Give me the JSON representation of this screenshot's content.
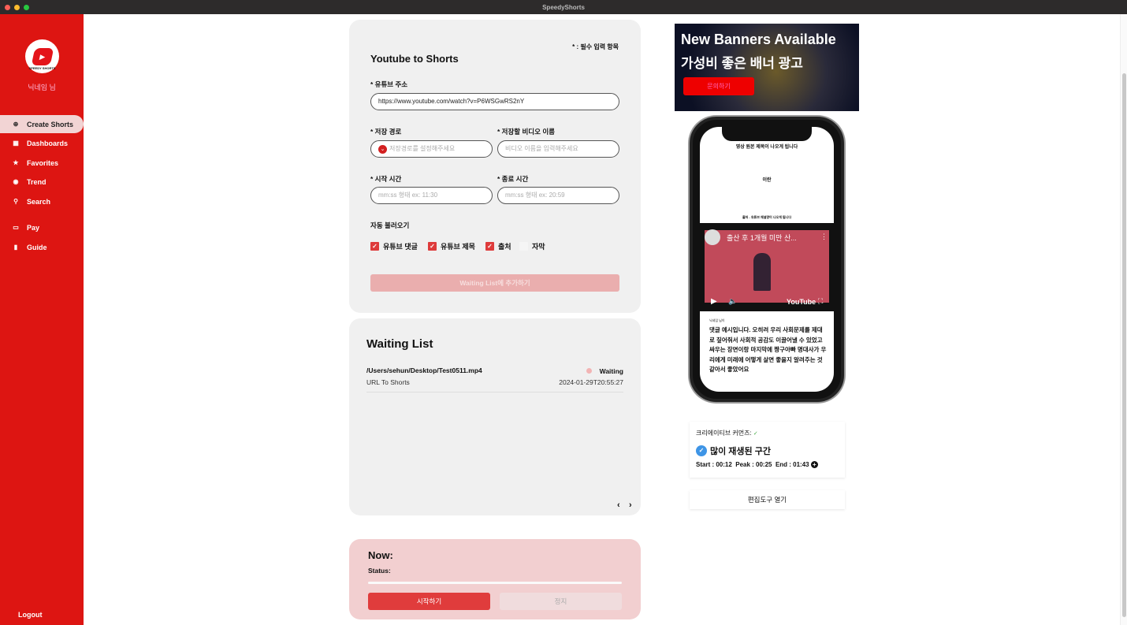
{
  "window": {
    "title": "SpeedyShorts"
  },
  "sidebar": {
    "logo_text": "SPEEDY SHORTS",
    "nickname": "닉네임 님",
    "items": [
      {
        "label": "Create Shorts",
        "icon": "plus-circle-icon"
      },
      {
        "label": "Dashboards",
        "icon": "dashboard-icon"
      },
      {
        "label": "Favorites",
        "icon": "star-icon"
      },
      {
        "label": "Trend",
        "icon": "compass-icon"
      },
      {
        "label": "Search",
        "icon": "search-icon"
      },
      {
        "label": "Pay",
        "icon": "card-icon"
      },
      {
        "label": "Guide",
        "icon": "book-icon"
      }
    ],
    "logout": "Logout",
    "color": "#dd1512"
  },
  "form": {
    "required_note": "* : 필수 입력 항목",
    "title": "Youtube to Shorts",
    "url_label": "* 유튜브 주소",
    "url_value": "https://www.youtube.com/watch?v=P6WSGwRS2nY",
    "path_label": "* 저장 경로",
    "path_placeholder": "저장경로를 설정해주세요",
    "name_label": "* 저장할 비디오 이름",
    "name_placeholder": "비디오 이름을 입력해주세요",
    "start_label": "* 시작 시간",
    "start_placeholder": "mm:ss 형태 ex: 11:30",
    "end_label": "* 종료 시간",
    "end_placeholder": "mm:ss 형태 ex: 20:59",
    "auto_label": "자동 불러오기",
    "checkboxes": [
      {
        "label": "유튜브 댓글",
        "checked": true
      },
      {
        "label": "유튜브 제목",
        "checked": true
      },
      {
        "label": "출처",
        "checked": true
      },
      {
        "label": "자막",
        "checked": false
      }
    ],
    "submit": "Waiting List에 추가하기"
  },
  "waiting": {
    "title": "Waiting List",
    "items": [
      {
        "path": "/Users/sehun/Desktop/Test0511.mp4",
        "type": "URL To Shorts",
        "status": "Waiting",
        "time": "2024-01-29T20:55:27"
      }
    ]
  },
  "now": {
    "title": "Now:",
    "status_label": "Status:",
    "start": "시작하기",
    "stop": "정지",
    "progress": 0
  },
  "banner": {
    "line1": "New Banners Available",
    "line2": "가성비 좋은 배너 광고",
    "button": "문의하기"
  },
  "preview": {
    "title_text": "영상 원본 제목이 나오게 됩니다",
    "middle": "이란",
    "source": "출처 - 유튜브 채널명이 나오게 됩니다",
    "video_title": "출산 후 1개월 미만 산...",
    "youtube": "YouTube",
    "comment_author": "닉네임 님이",
    "comment": "댓글 예시입니다. 오히려 우리 사회문제를 제대로 짚어줘서 사회적 공감도 이끌어낼 수 있었고 싸우는 장면이랑 마지막에 짱구아빠 명대사가 우리에게 미래에 어떻게 살면 좋을지 알려주는 것 같아서 좋았어요"
  },
  "info": {
    "cc_label": "크리에이티브 커먼즈:",
    "section": "많이 재생된 구간",
    "times": "Start : 00:12  Peak : 00:25  End : 01:43",
    "edit_button": "편집도구 열기"
  }
}
